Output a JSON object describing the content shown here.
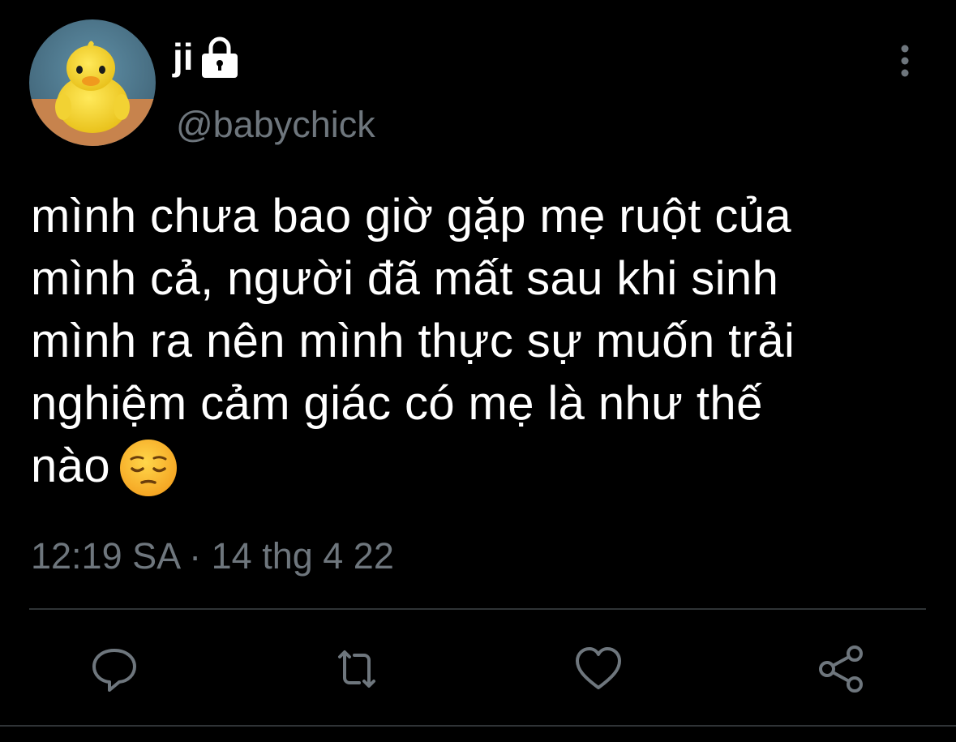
{
  "author": {
    "display_name": "ji",
    "handle": "@babychick",
    "protected": true,
    "avatar": "yellow-duckling-photo"
  },
  "tweet": {
    "lines": [
      "mình chưa bao giờ gặp mẹ ruột của",
      "mình cả, người đã mất sau khi sinh",
      "mình ra nên mình thực sự muốn trải",
      "nghiệm cảm giác có mẹ là như thế",
      "nào"
    ],
    "emoji": "😔",
    "timestamp": "12:19 SA · 14 thg 4 22"
  },
  "actions": {
    "reply_icon": "speech-bubble-icon",
    "retweet_icon": "retweet-arrows-icon",
    "like_icon": "heart-icon",
    "share_icon": "share-nodes-icon"
  },
  "colors": {
    "background": "#000000",
    "primary_text": "#ffffff",
    "secondary_text": "#6e767d",
    "divider": "#2f3336"
  }
}
